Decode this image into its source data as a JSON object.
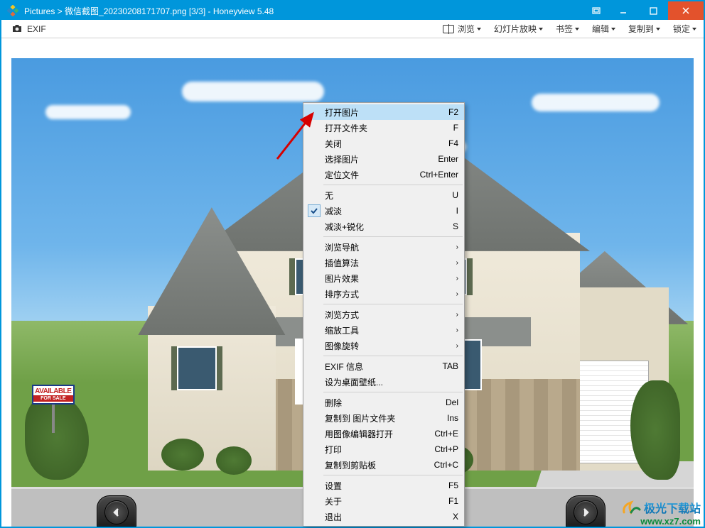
{
  "title": "Pictures  >  微信截图_20230208171707.png [3/3]  -  Honeyview 5.48",
  "menubar": {
    "exif": "EXIF",
    "items": {
      "browse": "浏览",
      "slideshow": "幻灯片放映",
      "bookmark": "书签",
      "edit": "编辑",
      "copyto": "复制到",
      "lock": "锁定"
    }
  },
  "sign": {
    "top": "AVAILABLE",
    "bottom": "FOR SALE"
  },
  "controls": {
    "plus": "+"
  },
  "context": {
    "open_image": "打开图片",
    "open_image_k": "F2",
    "open_folder": "打开文件夹",
    "open_folder_k": "F",
    "close": "关闭",
    "close_k": "F4",
    "select_image": "选择图片",
    "select_image_k": "Enter",
    "locate_file": "定位文件",
    "locate_file_k": "Ctrl+Enter",
    "none": "无",
    "none_k": "U",
    "fade": "减淡",
    "fade_k": "I",
    "fade_sharpen": "减淡+锐化",
    "fade_sharpen_k": "S",
    "nav": "浏览导航",
    "interp": "插值算法",
    "effect": "图片效果",
    "sort": "排序方式",
    "browse_mode": "浏览方式",
    "zoom_tool": "缩放工具",
    "rotate": "图像旋转",
    "exif_info": "EXIF 信息",
    "exif_info_k": "TAB",
    "wallpaper": "设为桌面壁纸...",
    "delete": "删除",
    "delete_k": "Del",
    "copy_to_folder": "复制到 图片文件夹",
    "copy_to_folder_k": "Ins",
    "open_editor": "用图像编辑器打开",
    "open_editor_k": "Ctrl+E",
    "print": "打印",
    "print_k": "Ctrl+P",
    "copy_clipboard": "复制到剪贴板",
    "copy_clipboard_k": "Ctrl+C",
    "settings": "设置",
    "settings_k": "F5",
    "about": "关于",
    "about_k": "F1",
    "exit": "退出",
    "exit_k": "X",
    "arrow": "›"
  },
  "watermark": {
    "text": "极光下载站",
    "url": "www.xz7.com"
  }
}
